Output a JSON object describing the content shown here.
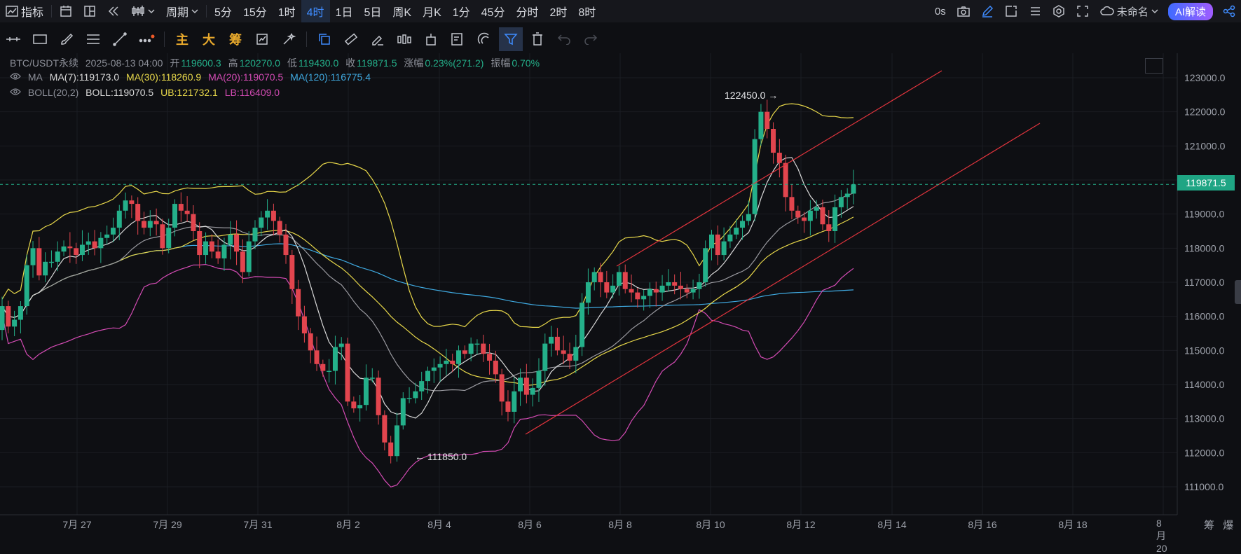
{
  "topbar": {
    "indicator_label": "指标",
    "period_label": "周期",
    "intervals": [
      "5分",
      "15分",
      "1时",
      "4时",
      "1日",
      "5日",
      "周K",
      "月K",
      "1分",
      "45分",
      "分时",
      "2时",
      "8时"
    ],
    "active_interval": "4时",
    "countdown": "0s",
    "layout_name": "未命名",
    "ai_button": "AI解读"
  },
  "toolbar": {
    "zhu": "主",
    "da": "大",
    "chou": "筹"
  },
  "info": {
    "symbol": "BTC/USDT永续",
    "time": "2025-08-13 04:00",
    "open_label": "开",
    "open": "119600.3",
    "high_label": "高",
    "high": "120270.0",
    "low_label": "低",
    "low": "119430.0",
    "close_label": "收",
    "close": "119871.5",
    "change_label": "涨幅",
    "change": "0.23%(271.2)",
    "amp_label": "振幅",
    "amp": "0.70%",
    "ma_label": "MA",
    "ma7": "MA(7):119173.0",
    "ma30": "MA(30):118260.9",
    "ma20": "MA(20):119070.5",
    "ma120": "MA(120):116775.4",
    "boll_label": "BOLL(20,2)",
    "boll": "BOLL:119070.5",
    "ub": "UB:121732.1",
    "lb": "LB:116409.0"
  },
  "colors": {
    "up": "#24b08a",
    "down": "#e2454e",
    "ma7": "#d9d9d9",
    "ma30": "#e8d84a",
    "ma120": "#3fa9e0",
    "lb": "#d44bb4",
    "trend": "#e0343d",
    "accent": "#3f8cff"
  },
  "chart_data": {
    "type": "candlestick",
    "y_ticks": [
      "123000.0",
      "122000.0",
      "121000.0",
      "120000.0",
      "119000.0",
      "118000.0",
      "117000.0",
      "116000.0",
      "115000.0",
      "114000.0",
      "113000.0",
      "112000.0",
      "111000.0"
    ],
    "x_labels": [
      "7月 27",
      "7月 29",
      "7月 31",
      "8月 2",
      "8月 4",
      "8月 6",
      "8月 8",
      "8月 10",
      "8月 12",
      "8月 14",
      "8月 16",
      "8月 18",
      "8月 20"
    ],
    "last_price": "119871.5",
    "annotations": {
      "high": "122450.0",
      "low": "111850.0"
    },
    "ylim": [
      110600,
      123600
    ],
    "close": [
      116300,
      115700,
      115900,
      116300,
      117500,
      118000,
      117200,
      117600,
      117600,
      117900,
      118050,
      118000,
      117800,
      118100,
      118200,
      118000,
      118300,
      118400,
      118600,
      119100,
      119400,
      119300,
      118800,
      118600,
      118800,
      118700,
      118000,
      118600,
      119300,
      119100,
      119000,
      118500,
      117800,
      118200,
      117900,
      117700,
      118100,
      118400,
      117900,
      117300,
      118200,
      118600,
      118900,
      119100,
      118800,
      118400,
      117800,
      116800,
      116000,
      115500,
      115000,
      114600,
      114400,
      114400,
      115100,
      115200,
      113500,
      113300,
      113400,
      114200,
      114200,
      113100,
      112300,
      111900,
      112800,
      113600,
      113600,
      113800,
      114100,
      114400,
      114500,
      114600,
      114700,
      114600,
      115000,
      114900,
      115200,
      115200,
      114900,
      114700,
      114300,
      113500,
      113200,
      113800,
      114200,
      113700,
      113900,
      114400,
      115200,
      115400,
      115000,
      114900,
      114700,
      115100,
      116400,
      117000,
      117300,
      117000,
      116700,
      116900,
      117300,
      116800,
      116700,
      116500,
      116600,
      116800,
      116700,
      116900,
      117000,
      116900,
      116800,
      116700,
      116800,
      117000,
      118000,
      118400,
      117800,
      118200,
      118400,
      118600,
      118800,
      119000,
      121200,
      122000,
      121500,
      120800,
      120500,
      119500,
      119100,
      118900,
      118800,
      119100,
      119200,
      118700,
      118500,
      119200,
      119500,
      119600,
      119871
    ]
  }
}
